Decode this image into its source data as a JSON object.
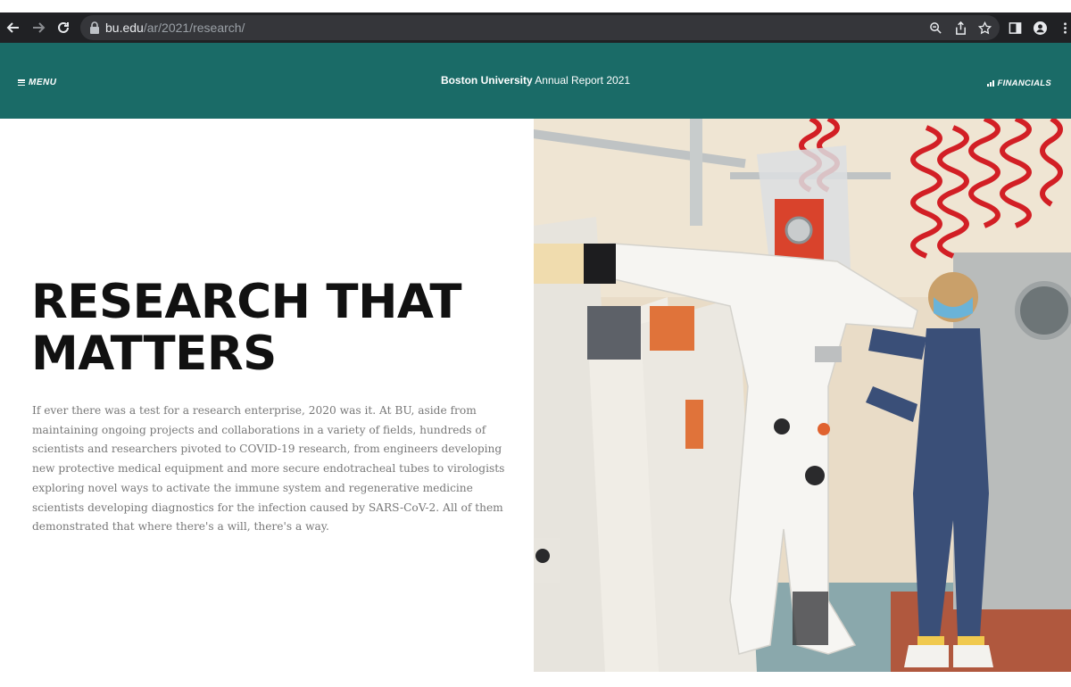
{
  "browser": {
    "url_host": "bu.edu",
    "url_path": "/ar/2021/research/"
  },
  "header": {
    "menu_label": "MENU",
    "title_bold": "Boston University",
    "title_rest": " Annual Report 2021",
    "financials_label": "FINANCIALS",
    "bg_color": "#1a6b67"
  },
  "main": {
    "headline_line1": "RESEARCH THAT",
    "headline_line2": "MATTERS",
    "body": "If ever there was a test for a research enterprise, 2020 was it. At BU, aside from maintaining ongoing projects and collaborations in a variety of fields, hundreds of scientists and researchers pivoted to COVID-19 research, from engineers developing new protective medical equipment and more secure endotracheal tubes to virologists exploring novel ways to activate the immune system and regenerative medicine scientists developing diagnostics for the infection caused by SARS-CoV-2. All of them demonstrated that where there's a will, there's a way."
  },
  "photo": {
    "icon": "lab-photo"
  }
}
